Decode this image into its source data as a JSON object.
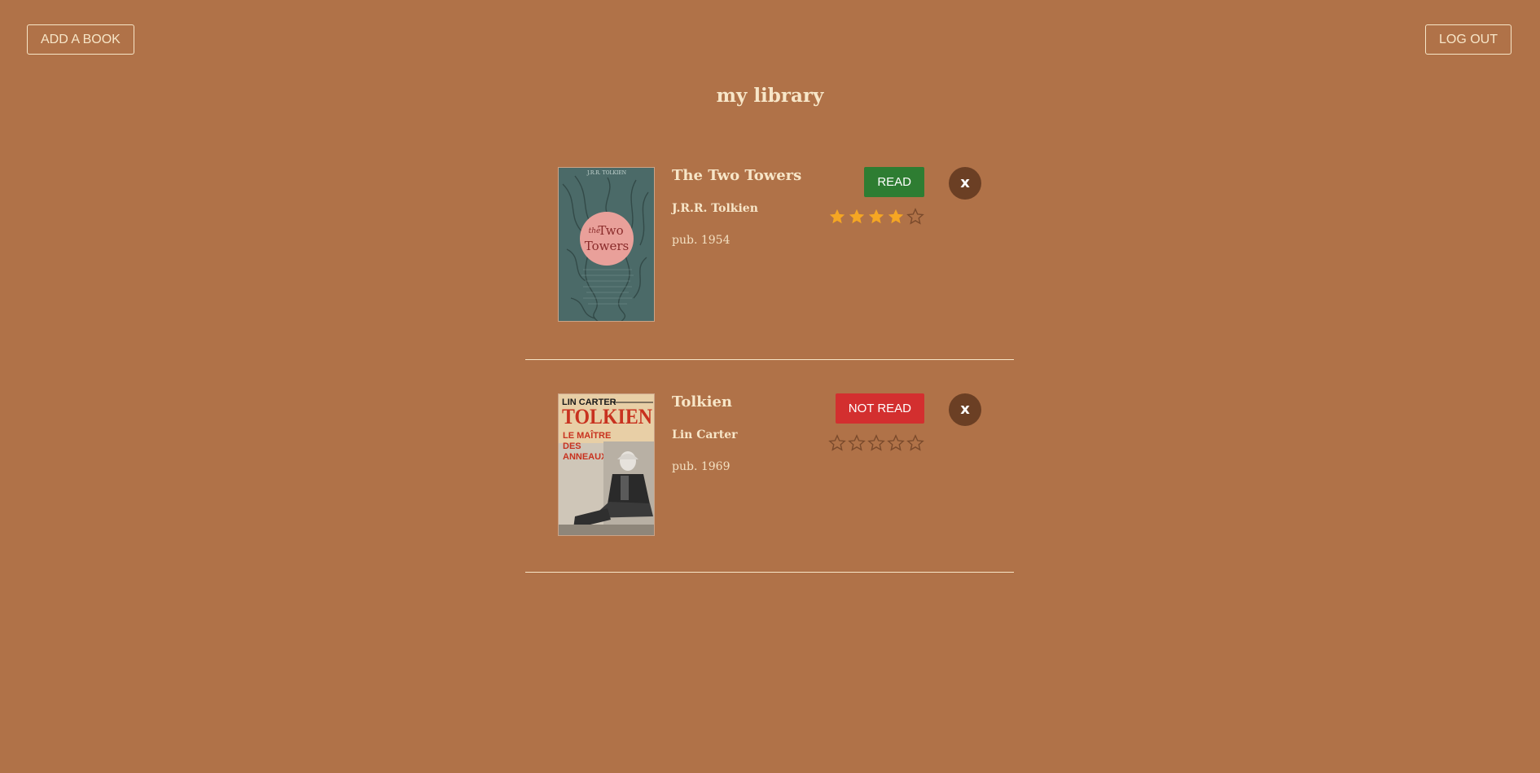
{
  "header": {
    "add_label": "ADD A BOOK",
    "logout_label": "LOG OUT",
    "title": "my library"
  },
  "colors": {
    "background": "#b07248",
    "text": "#f7e6c8",
    "read": "#2e7d32",
    "not_read": "#d32f2f",
    "remove": "#6b3f24",
    "star_filled": "#f5a623",
    "star_empty": "#7a4a2c"
  },
  "books": [
    {
      "title": "The Two Towers",
      "author": "J.R.R. Tolkien",
      "published": "pub. 1954",
      "status": "READ",
      "rating": 4,
      "max_rating": 5,
      "remove_label": "x",
      "cover": {
        "top_text": "J.R.R. TOLKIEN",
        "line1": "the",
        "line2": "Two",
        "line3": "Towers"
      }
    },
    {
      "title": "Tolkien",
      "author": "Lin Carter",
      "published": "pub. 1969",
      "status": "NOT READ",
      "rating": 0,
      "max_rating": 5,
      "remove_label": "x",
      "cover": {
        "top_text": "LIN CARTER",
        "line1": "TOLKIEN",
        "line2": "LE MAÎTRE",
        "line3": "DES",
        "line4": "ANNEAUX"
      }
    }
  ]
}
